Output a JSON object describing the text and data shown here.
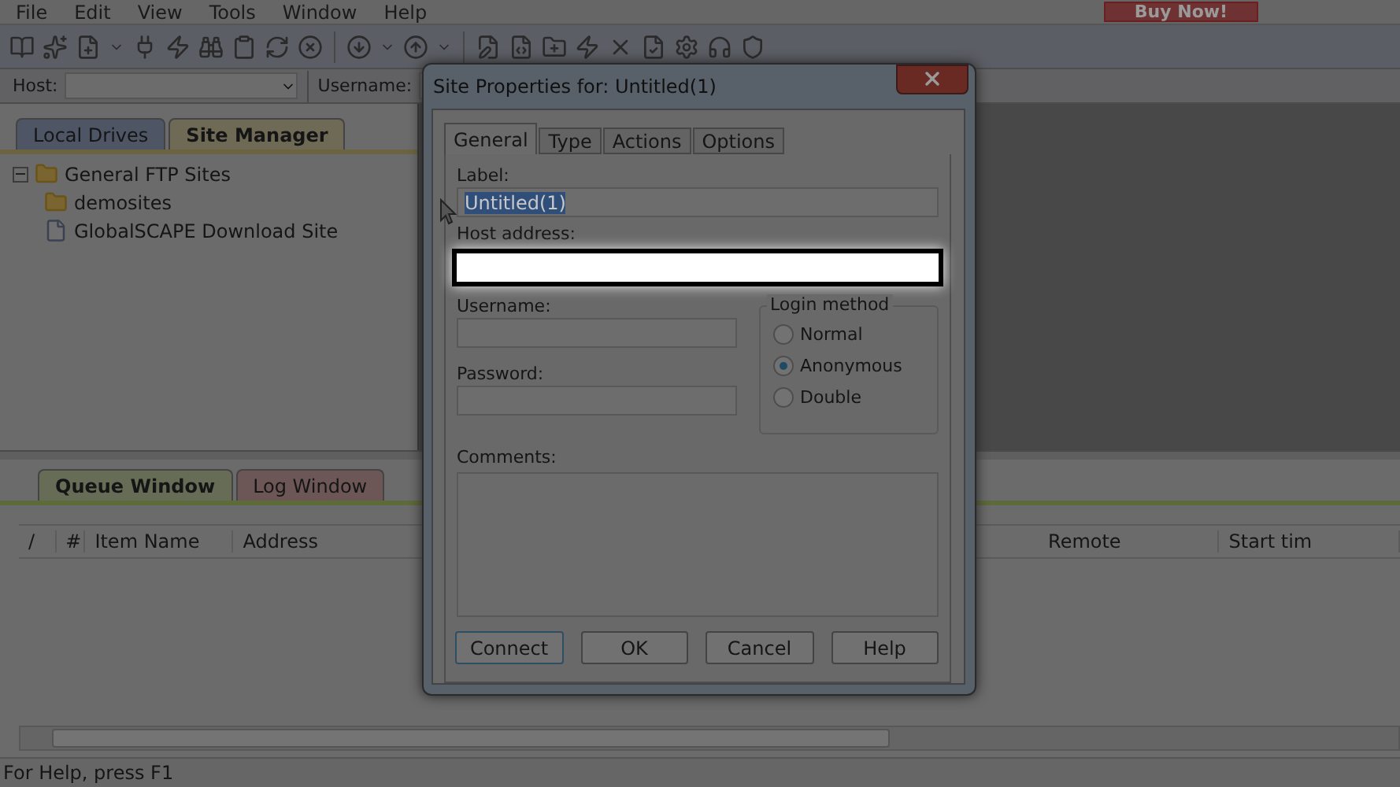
{
  "menu": [
    "File",
    "Edit",
    "View",
    "Tools",
    "Window",
    "Help"
  ],
  "buy_button": "Buy Now!",
  "quick_connect": {
    "host_label": "Host:",
    "username_label": "Username:"
  },
  "left_tabs": [
    {
      "label": "Local Drives",
      "selected": false
    },
    {
      "label": "Site Manager",
      "selected": true
    }
  ],
  "tree": [
    {
      "label": "General FTP Sites",
      "kind": "folder",
      "expanded": true,
      "children": [
        {
          "label": "demosites",
          "kind": "folder"
        },
        {
          "label": "GlobalSCAPE Download Site",
          "kind": "file"
        }
      ]
    }
  ],
  "bottom_tabs": [
    {
      "label": "Queue Window",
      "selected": true
    },
    {
      "label": "Log Window",
      "selected": false
    }
  ],
  "queue_table": {
    "columns": [
      "/",
      "#",
      "Item Name",
      "Address",
      "Remote",
      "Start tim"
    ]
  },
  "status_bar": "For Help, press F1",
  "dialog": {
    "title": "Site Properties for: Untitled(1)",
    "tabs": [
      {
        "label": "General",
        "selected": true
      },
      {
        "label": "Type",
        "selected": false
      },
      {
        "label": "Actions",
        "selected": false
      },
      {
        "label": "Options",
        "selected": false
      }
    ],
    "label_field": {
      "label": "Label:",
      "value": "Untitled(1)",
      "text_selected": true
    },
    "host_field": {
      "label": "Host address:",
      "focused": true
    },
    "username_field": {
      "label": "Username:"
    },
    "password_field": {
      "label": "Password:"
    },
    "login_method": {
      "title": "Login method",
      "options": [
        {
          "label": "Normal",
          "selected": false
        },
        {
          "label": "Anonymous",
          "selected": true
        },
        {
          "label": "Double",
          "selected": false
        }
      ]
    },
    "comments_label": "Comments:",
    "buttons": [
      {
        "label": "Connect",
        "default": true
      },
      {
        "label": "OK",
        "default": false
      },
      {
        "label": "Cancel",
        "default": false
      },
      {
        "label": "Help",
        "default": false
      }
    ]
  }
}
